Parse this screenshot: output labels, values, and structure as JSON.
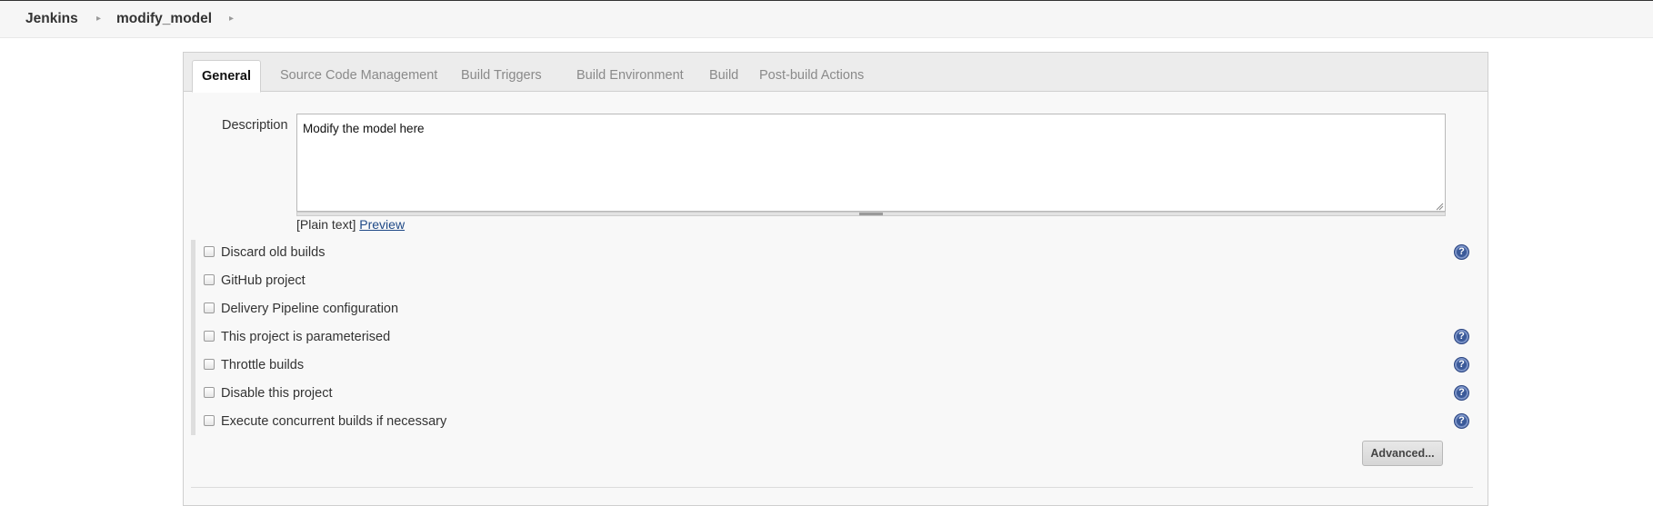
{
  "breadcrumb": {
    "items": [
      "Jenkins",
      "modify_model"
    ],
    "separator": "▸"
  },
  "tabs": [
    {
      "label": "General",
      "active": true
    },
    {
      "label": "Source Code Management",
      "active": false
    },
    {
      "label": "Build Triggers",
      "active": false
    },
    {
      "label": "Build Environment",
      "active": false
    },
    {
      "label": "Build",
      "active": false
    },
    {
      "label": "Post-build Actions",
      "active": false
    }
  ],
  "description": {
    "label": "Description",
    "value": "Modify the model here",
    "format_text": "[Plain text]",
    "preview_link": "Preview"
  },
  "options": [
    {
      "label": "Discard old builds",
      "checked": false,
      "help": true
    },
    {
      "label": "GitHub project",
      "checked": false,
      "help": false
    },
    {
      "label": "Delivery Pipeline configuration",
      "checked": false,
      "help": false
    },
    {
      "label": "This project is parameterised",
      "checked": false,
      "help": true
    },
    {
      "label": "Throttle builds",
      "checked": false,
      "help": true
    },
    {
      "label": "Disable this project",
      "checked": false,
      "help": true
    },
    {
      "label": "Execute concurrent builds if necessary",
      "checked": false,
      "help": true
    }
  ],
  "help_glyph": "?",
  "advanced_button": "Advanced...",
  "colors": {
    "accent": "#3b5a99",
    "link": "#204a87",
    "panel_bg": "#f8f8f8"
  }
}
